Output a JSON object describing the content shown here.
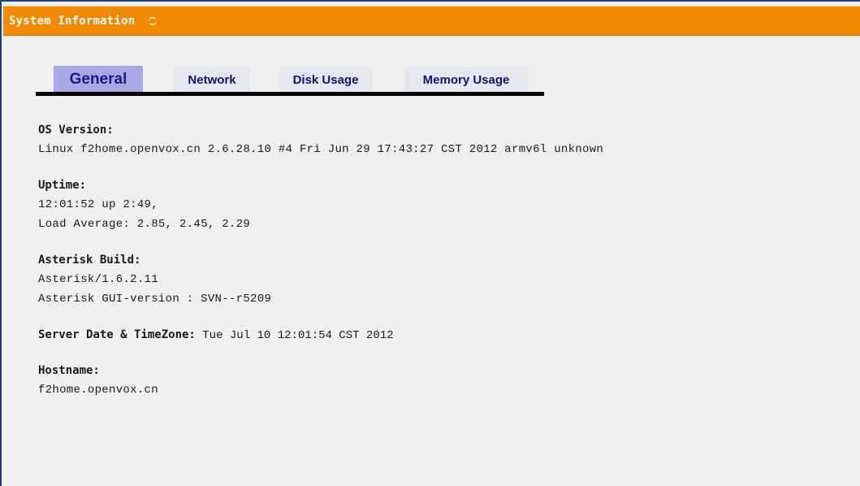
{
  "header": {
    "title": "System Information",
    "refresh_icon": "refresh-icon",
    "background_color": "#f28a00"
  },
  "tabs": [
    {
      "label": "General",
      "active": true
    },
    {
      "label": "Network",
      "active": false
    },
    {
      "label": "Disk Usage",
      "active": false
    },
    {
      "label": "Memory Usage",
      "active": false
    }
  ],
  "os_version": {
    "label": "OS Version:",
    "value": "Linux f2home.openvox.cn 2.6.28.10 #4 Fri Jun 29 17:43:27 CST 2012 armv6l unknown"
  },
  "uptime": {
    "label": "Uptime:",
    "value": "12:01:52 up 2:49,",
    "load_average": "Load Average: 2.85, 2.45, 2.29"
  },
  "asterisk_build": {
    "label": "Asterisk Build:",
    "version": "Asterisk/1.6.2.11",
    "gui_version": "Asterisk GUI-version : SVN--r5209"
  },
  "server_date": {
    "label": "Server Date & TimeZone:",
    "value": "Tue Jul 10 12:01:54 CST 2012"
  },
  "hostname": {
    "label": "Hostname:",
    "value": "f2home.openvox.cn"
  }
}
